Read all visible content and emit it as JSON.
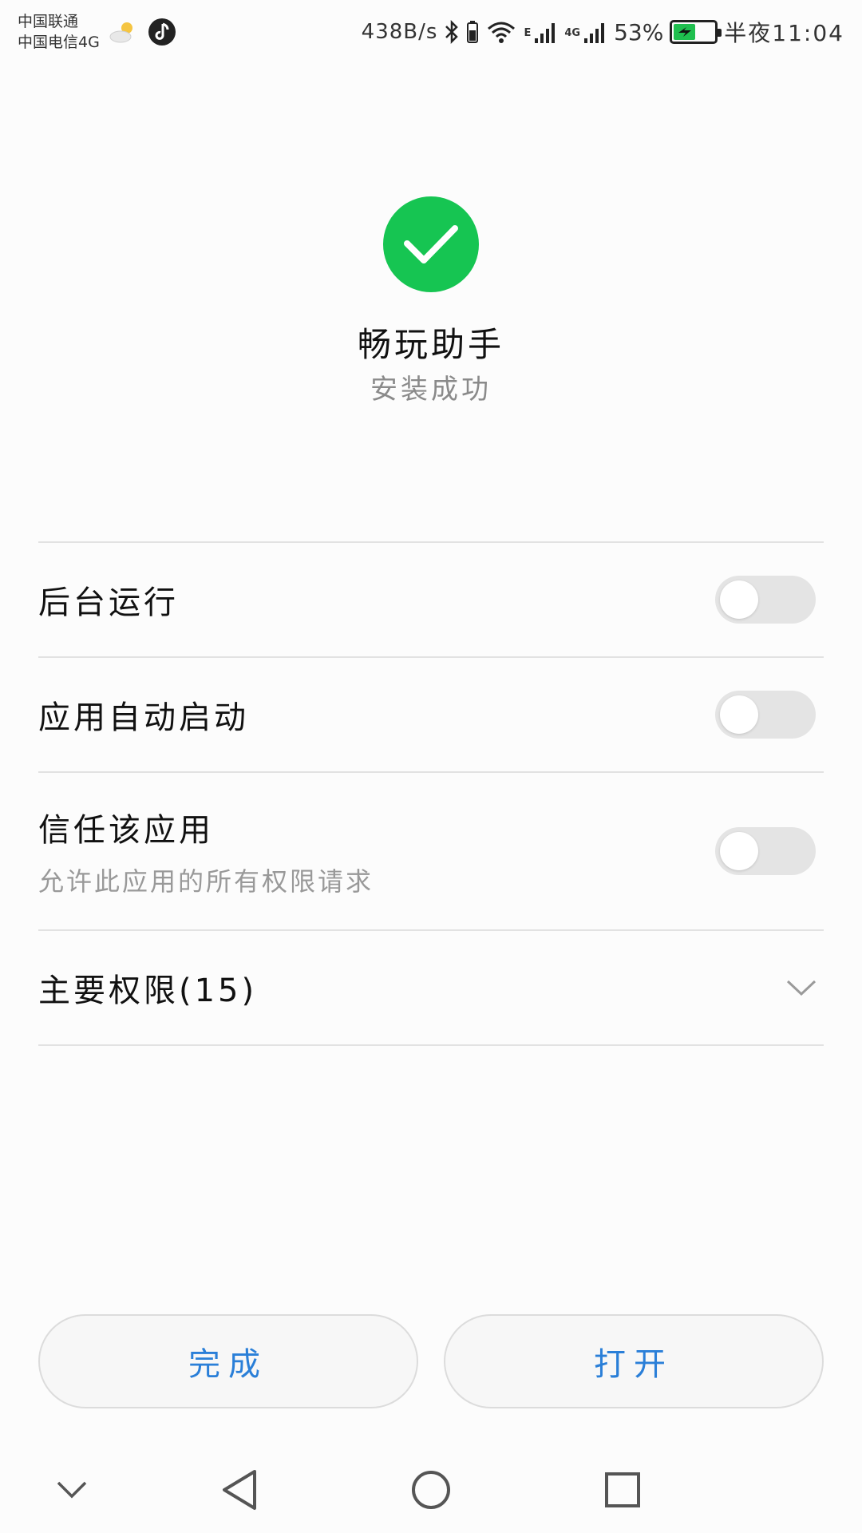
{
  "status_bar": {
    "carrier_1": "中国联通",
    "carrier_2": "中国电信4G",
    "net_speed": "438B/s",
    "signal_1_tag": "E",
    "signal_2_tag": "4G",
    "battery_percent": "53%",
    "battery_level": 0.53,
    "time": "半夜11:04"
  },
  "header": {
    "app_name": "畅玩助手",
    "status": "安装成功",
    "status_color": "#16c552"
  },
  "settings": [
    {
      "title": "后台运行",
      "enabled": false
    },
    {
      "title": "应用自动启动",
      "enabled": false
    },
    {
      "title": "信任该应用",
      "subtitle": "允许此应用的所有权限请求",
      "enabled": false
    }
  ],
  "permissions": {
    "title": "主要权限(15)"
  },
  "buttons": {
    "done": "完成",
    "open": "打开",
    "accent": "#2a7fd8"
  },
  "nav": {
    "icons": [
      "chevron-down-icon",
      "back-triangle-icon",
      "home-circle-icon",
      "recents-square-icon"
    ]
  }
}
